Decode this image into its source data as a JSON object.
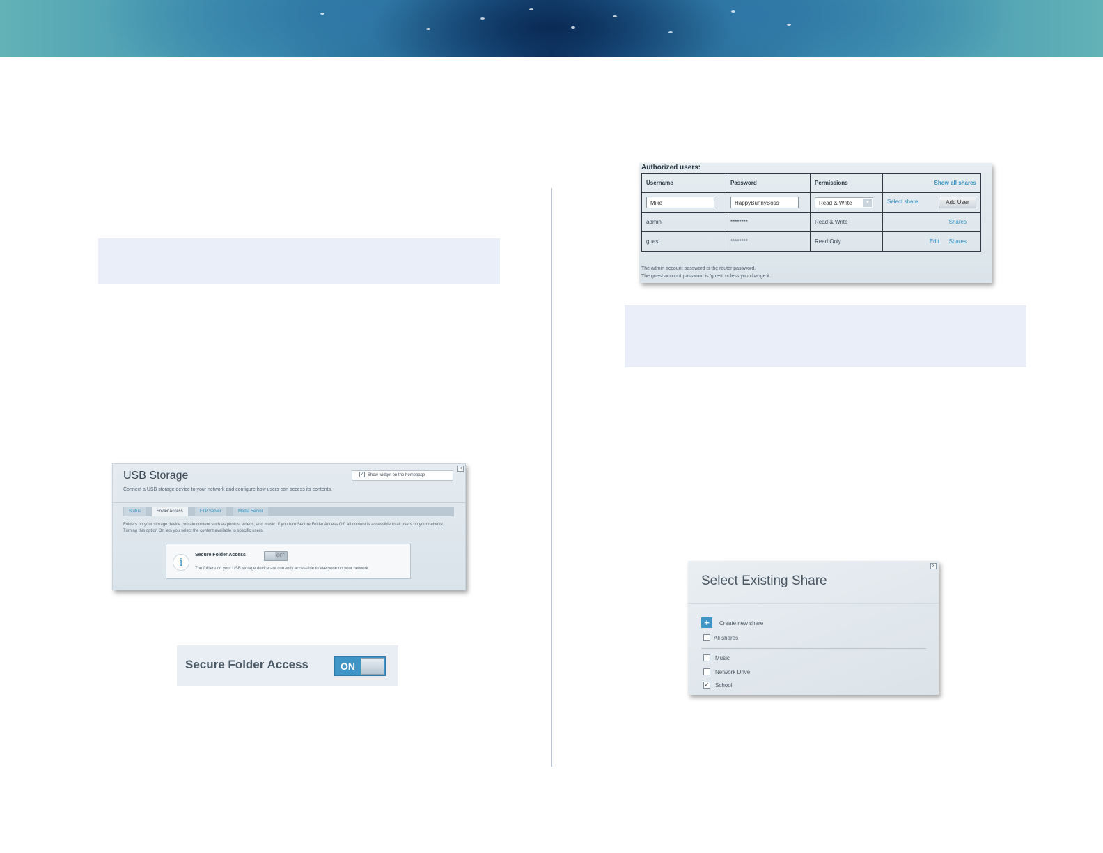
{
  "usb_storage": {
    "title": "USB Storage",
    "subtitle": "Connect a USB storage device to your network and configure how users can access its contents.",
    "widget_checkbox_label": "Show widget on the homepage",
    "tabs": [
      "Status",
      "Folder Access",
      "FTP Server",
      "Media Server"
    ],
    "active_tab": "Folder Access",
    "description": "Folders on your storage device contain content such as photos, videos, and music. If you turn Secure Folder Access Off, all content is accessible to all users on your network. Turning this option On lets you select the content available to specific users.",
    "secure_folder_label": "Secure Folder Access",
    "toggle_state": "OFF",
    "info_text": "The folders on your USB storage device are currently accessible to everyone on your network."
  },
  "secure_folder_zoom": {
    "label": "Secure Folder Access",
    "toggle_state": "ON"
  },
  "authorized_users": {
    "heading": "Authorized users:",
    "columns": [
      "Username",
      "Password",
      "Permissions",
      "Show all shares"
    ],
    "new_user": {
      "username": "Mike",
      "password": "HappyBunnyBoss",
      "permission": "Read & Write",
      "select_share": "Select share",
      "add_button": "Add User"
    },
    "rows": [
      {
        "username": "admin",
        "password": "********",
        "permission": "Read & Write",
        "edit": "",
        "shares": "Shares"
      },
      {
        "username": "guest",
        "password": "********",
        "permission": "Read Only",
        "edit": "Edit",
        "shares": "Shares"
      }
    ],
    "footer_line1": "The admin account password is the router password.",
    "footer_line2": "The guest account password is 'guest' unless you change it."
  },
  "select_share": {
    "title": "Select Existing Share",
    "create_new": "Create new share",
    "all_shares": "All shares",
    "items": [
      {
        "label": "Music",
        "checked": false
      },
      {
        "label": "Network Drive",
        "checked": false
      },
      {
        "label": "School",
        "checked": true
      }
    ]
  },
  "colors": {
    "accent": "#3f95c6",
    "link": "#2d8fc0",
    "note_box": "#e9eef8"
  }
}
